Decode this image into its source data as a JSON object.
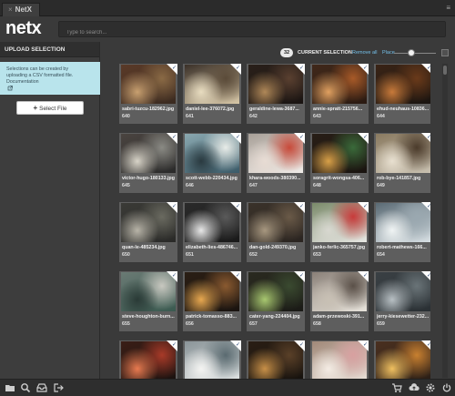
{
  "window": {
    "tab_title": "NetX",
    "close_glyph": "×",
    "menu_glyph": "≡"
  },
  "header": {
    "logo": "netx",
    "search_placeholder": "Type to search..."
  },
  "sidebar": {
    "title": "UPLOAD SELECTION",
    "info_lines": [
      "Selections can be created by",
      "uploading a CSV formatted file.",
      "Documentation"
    ],
    "select_file_label": "Select File"
  },
  "selection_bar": {
    "count": "32",
    "title": "CURRENT SELECTION",
    "remove_all": "Remove all",
    "place": "Place"
  },
  "check_glyph": "✓",
  "colors": {
    "accent_link": "#74c0ea",
    "info_bg": "#b9e4ec",
    "tile_bg": "#5e5e5e",
    "panel_bg": "#3a3a3a"
  },
  "assets": [
    {
      "file": "sabri-tuzcu-182962.jpg",
      "id": "640",
      "palette": [
        "#3a2a20",
        "#8a6a45",
        "#c8a070",
        "#5a3a28"
      ]
    },
    {
      "file": "daniel-lee-376072.jpg",
      "id": "641",
      "palette": [
        "#d8c8a8",
        "#5a4a38",
        "#e8dcc0",
        "#3a3028"
      ]
    },
    {
      "file": "geraldine-lewa-3687...",
      "id": "642",
      "palette": [
        "#1a1412",
        "#5a4030",
        "#b08858",
        "#2a201a"
      ]
    },
    {
      "file": "annie-spratt-215756...",
      "id": "643",
      "palette": [
        "#2a1a12",
        "#a85a28",
        "#e0a060",
        "#40281a"
      ]
    },
    {
      "file": "ehud-neuhaus-10836...",
      "id": "644",
      "palette": [
        "#1a1410",
        "#6a3a1a",
        "#c87a3a",
        "#3a2416"
      ]
    },
    {
      "file": "victor-hugo-180133.jpg",
      "id": "645",
      "palette": [
        "#2a2a2a",
        "#8a8a84",
        "#d8d4c8",
        "#4a4440"
      ]
    },
    {
      "file": "scott-webb-220434.jpg",
      "id": "646",
      "palette": [
        "#3a5a68",
        "#e8ece8",
        "#2a3a40",
        "#8aa8b0"
      ]
    },
    {
      "file": "khara-woods-380390...",
      "id": "647",
      "palette": [
        "#f0ece8",
        "#c84a3a",
        "#e8dcd4",
        "#a8a098"
      ]
    },
    {
      "file": "soragrit-wongsa-406...",
      "id": "648",
      "palette": [
        "#1a1410",
        "#3a6a3a",
        "#d8a048",
        "#281e16"
      ]
    },
    {
      "file": "rob-bye-141857.jpg",
      "id": "649",
      "palette": [
        "#c8c0b0",
        "#4a3a2a",
        "#e8e0d0",
        "#8a7a60"
      ]
    },
    {
      "file": "quan-le-485234.jpg",
      "id": "650",
      "palette": [
        "#2a2a28",
        "#6a6a60",
        "#b8b4a8",
        "#3a3a36"
      ]
    },
    {
      "file": "elizabeth-lies-486746...",
      "id": "651",
      "palette": [
        "#1a1a1a",
        "#5a5a5a",
        "#e8e8e8",
        "#2a2a2a"
      ]
    },
    {
      "file": "dan-gold-249370.jpg",
      "id": "652",
      "palette": [
        "#2a2420",
        "#6a5a48",
        "#a89880",
        "#3a322a"
      ]
    },
    {
      "file": "janko-ferlic-365757.jpg",
      "id": "653",
      "palette": [
        "#e8e8e4",
        "#c83a3a",
        "#d8d8d0",
        "#7a8a6a"
      ]
    },
    {
      "file": "robert-mathews-166...",
      "id": "654",
      "palette": [
        "#d8e0e4",
        "#9aa8b0",
        "#f0f4f4",
        "#5a6a74"
      ]
    },
    {
      "file": "steve-houghton-burn...",
      "id": "655",
      "palette": [
        "#3a5a50",
        "#c8c8c0",
        "#2a3a36",
        "#6a7a74"
      ]
    },
    {
      "file": "patrick-tomasso-883...",
      "id": "656",
      "palette": [
        "#1a1410",
        "#8a5a30",
        "#e8a850",
        "#2a1e14"
      ]
    },
    {
      "file": "cater-yang-224404.jpg",
      "id": "657",
      "palette": [
        "#1a1a16",
        "#3a4a30",
        "#a8c870",
        "#2a2a20"
      ]
    },
    {
      "file": "adam-przewoski-391...",
      "id": "658",
      "palette": [
        "#e8e4dc",
        "#5a5048",
        "#c8c0b4",
        "#8a8078"
      ]
    },
    {
      "file": "jerry-kiesewetter-232...",
      "id": "659",
      "palette": [
        "#2a3034",
        "#6a7478",
        "#b8c0c4",
        "#3a4044"
      ]
    },
    {
      "file": "",
      "id": "",
      "palette": [
        "#1a1210",
        "#a83a28",
        "#e87a50",
        "#3a1e16"
      ]
    },
    {
      "file": "",
      "id": "",
      "palette": [
        "#e0e4e4",
        "#5a6a70",
        "#f4f4f2",
        "#8a9498"
      ]
    },
    {
      "file": "",
      "id": "",
      "palette": [
        "#16120e",
        "#5a4028",
        "#c89048",
        "#2a1e14"
      ]
    },
    {
      "file": "",
      "id": "",
      "palette": [
        "#e8e0d8",
        "#d8a0a0",
        "#f4ece4",
        "#a08878"
      ]
    },
    {
      "file": "",
      "id": "",
      "palette": [
        "#2a1e16",
        "#c88030",
        "#f0c060",
        "#4a3020"
      ]
    }
  ],
  "bottom_icons": [
    "folder-icon",
    "search-icon",
    "inbox-icon",
    "logout-icon",
    "cart-icon",
    "cloud-upload-icon",
    "settings-icon",
    "power-icon"
  ]
}
